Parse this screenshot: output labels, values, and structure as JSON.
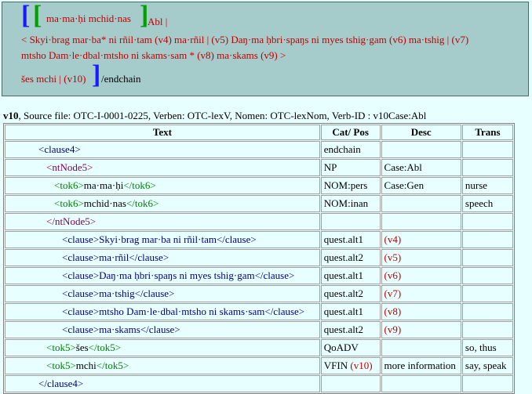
{
  "header": {
    "fragment1": "ma·ma·ḥi mchid·nas",
    "abl": "Abl |",
    "line2": "< Skyi·brag mar·ba* ni rñil·tam (v4) ma·rñil | (v5) Daŋ·ma ḥbri·spaŋs ni myes tshig·gam (v6) ma·tshig | (v7)",
    "line3": "mtsho Dam·le·dbal·mtsho ni skams·sam * (v8) ma·skams (v9) >",
    "line4_text": "šes mchi | (v10)",
    "endchain": "/endchain"
  },
  "info": {
    "id": "v10",
    "rest": ", Source file: OTC-I-0001-0225, Verben: OTC-lexV, Nomen: OTC-lexNom, Verb-ID : v10Case:Abl"
  },
  "table": {
    "headers": [
      "Text",
      "Cat/ Pos",
      "Desc",
      "Trans"
    ],
    "rows": [
      {
        "text": "<clause4>",
        "cat": "endchain",
        "desc": "",
        "trans": ""
      },
      {
        "text": "<ntNode5>",
        "cat": "NP",
        "desc": "Case:Abl",
        "trans": ""
      },
      {
        "pre": "<tok6>",
        "word": "ma·ma·ḥi",
        "post": "</tok6>",
        "cat": "NOM:pers",
        "desc": "Case:Gen",
        "trans": "nurse"
      },
      {
        "pre": "<tok6>",
        "word": "mchid·nas",
        "post": "</tok6>",
        "cat": "NOM:inan",
        "desc": "",
        "trans": "speech"
      },
      {
        "text": "</ntNode5>",
        "cat": "",
        "desc": "",
        "trans": ""
      },
      {
        "text": "<clause>Skyi·brag mar·ba ni rñil·tam</clause>",
        "cat": "quest.alt1",
        "desc": "(v4)",
        "trans": ""
      },
      {
        "text": "<clause>ma·rñil</clause>",
        "cat": "quest.alt2",
        "desc": "(v5)",
        "trans": ""
      },
      {
        "text": "<clause>Daŋ·ma ḥbri·spaŋs ni myes tshig·gam</clause>",
        "cat": "quest.alt1",
        "desc": "(v6)",
        "trans": ""
      },
      {
        "text": "<clause>ma·tshig</clause>",
        "cat": "quest.alt2",
        "desc": "(v7)",
        "trans": ""
      },
      {
        "text": "<clause>mtsho Dam·le·dbal·mtsho ni skams·sam</clause>",
        "cat": "quest.alt1",
        "desc": "(v8)",
        "trans": ""
      },
      {
        "text": "<clause>ma·skams</clause>",
        "cat": "quest.alt2",
        "desc": "(v9)",
        "trans": ""
      },
      {
        "pre": "<tok5>",
        "word": "šes",
        "post": "</tok5>",
        "cat": "QoADV",
        "desc": "",
        "trans": "so, thus"
      },
      {
        "pre": "<tok5>",
        "word": "mchi",
        "post": "</tok5>",
        "cat": "VFIN",
        "cat_v": "(v10)",
        "desc": "more information",
        "trans": "say, speak"
      },
      {
        "text": "</clause4>",
        "cat": "",
        "desc": "",
        "trans": ""
      }
    ]
  },
  "colors": {
    "top_box_bg": "#a6cbcb",
    "page_bg": "#e8ffff",
    "red": "#c00000",
    "green": "#008000",
    "navy": "#000080",
    "purple": "#800060"
  }
}
